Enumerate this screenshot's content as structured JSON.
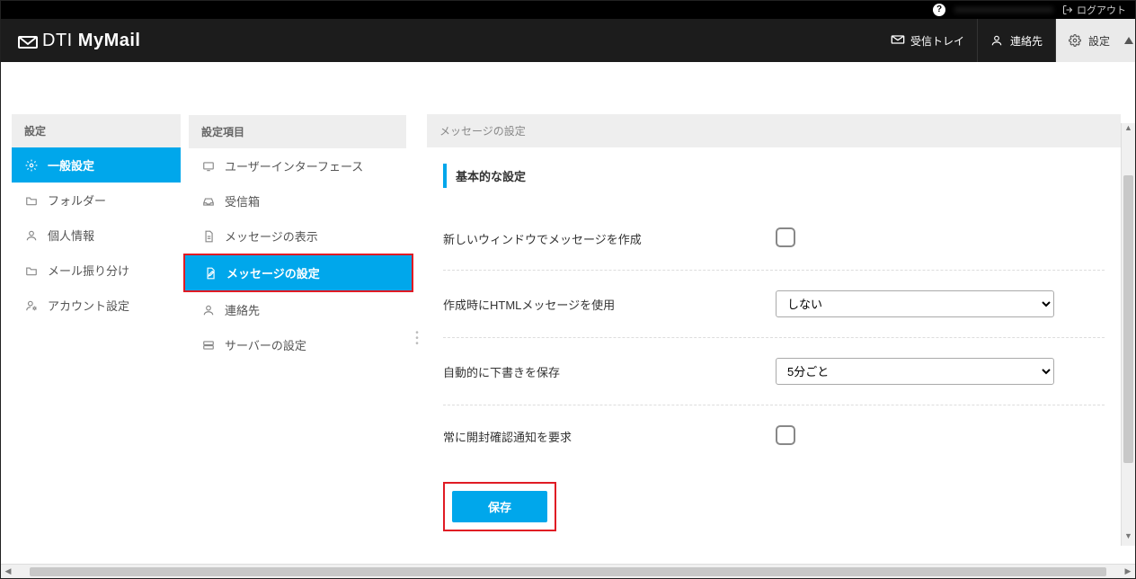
{
  "topbar": {
    "user_blurred": "xxxxxxxxxxxxxxxxxxxx",
    "logout": "ログアウト"
  },
  "brand": {
    "thin": "DTI ",
    "bold": "MyMail"
  },
  "nav": {
    "inbox": "受信トレイ",
    "contacts": "連絡先",
    "settings": "設定"
  },
  "col1": {
    "header": "設定",
    "items": [
      {
        "label": "一般設定",
        "active": true
      },
      {
        "label": "フォルダー"
      },
      {
        "label": "個人情報"
      },
      {
        "label": "メール振り分け"
      },
      {
        "label": "アカウント設定"
      }
    ]
  },
  "col2": {
    "header": "設定項目",
    "items": [
      {
        "label": "ユーザーインターフェース"
      },
      {
        "label": "受信箱"
      },
      {
        "label": "メッセージの表示"
      },
      {
        "label": "メッセージの設定",
        "active": true
      },
      {
        "label": "連絡先"
      },
      {
        "label": "サーバーの設定"
      }
    ]
  },
  "panel": {
    "header": "メッセージの設定",
    "section": "基本的な設定",
    "rows": {
      "new_window": "新しいウィンドウでメッセージを作成",
      "use_html": "作成時にHTMLメッセージを使用",
      "use_html_value": "しない",
      "autosave": "自動的に下書きを保存",
      "autosave_value": "5分ごと",
      "read_receipt": "常に開封確認通知を要求"
    },
    "save": "保存"
  }
}
